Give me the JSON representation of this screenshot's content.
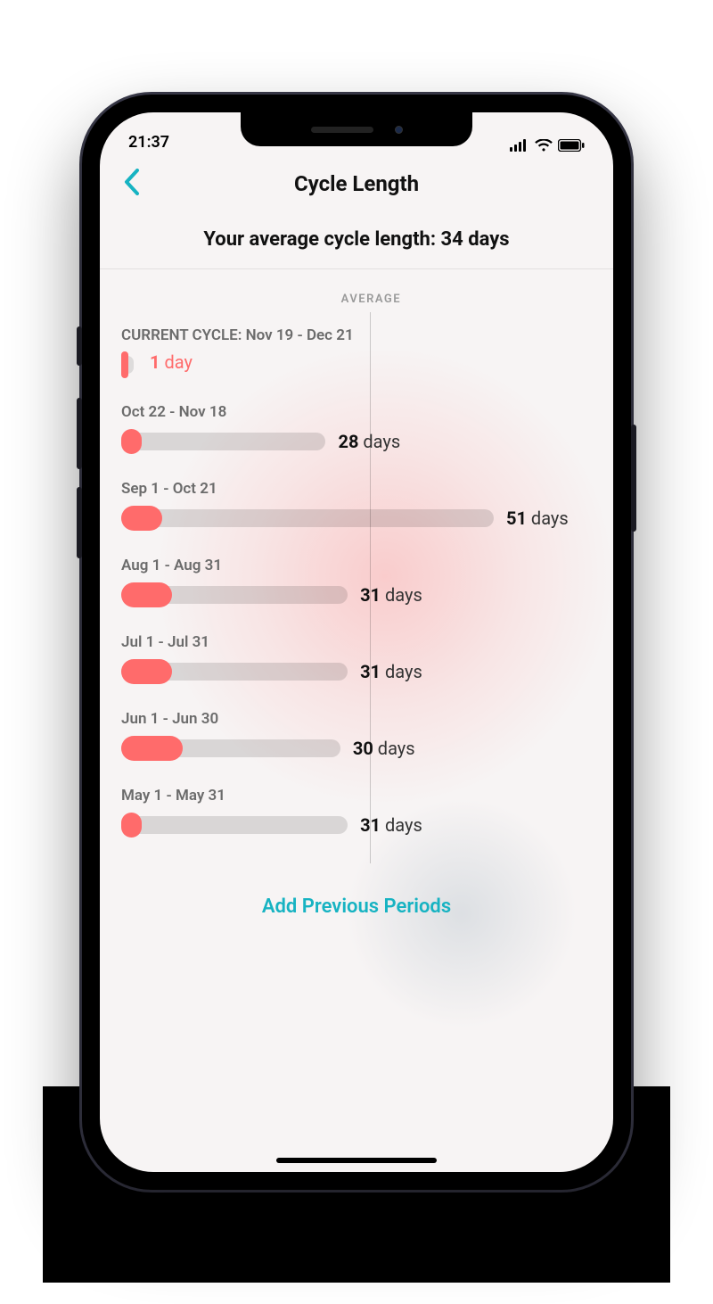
{
  "status_bar": {
    "time": "21:37"
  },
  "nav": {
    "title": "Cycle Length"
  },
  "summary": {
    "text": "Your average cycle length: 34 days"
  },
  "chart_data": {
    "type": "bar",
    "title": "Cycle Length",
    "ylabel": "days",
    "average": 34,
    "average_label": "AVERAGE",
    "max_bar_days": 51,
    "series": [
      {
        "name": "CURRENT CYCLE: Nov 19 - Dec 21",
        "value": 1,
        "unit": "day",
        "is_current": true,
        "period_days": 1
      },
      {
        "name": "Oct 22 - Nov 18",
        "value": 28,
        "unit": "days",
        "is_current": false,
        "period_days": 2
      },
      {
        "name": "Sep 1 - Oct 21",
        "value": 51,
        "unit": "days",
        "is_current": false,
        "period_days": 4
      },
      {
        "name": "Aug 1 - Aug 31",
        "value": 31,
        "unit": "days",
        "is_current": false,
        "period_days": 5
      },
      {
        "name": "Jul 1 - Jul 31",
        "value": 31,
        "unit": "days",
        "is_current": false,
        "period_days": 5
      },
      {
        "name": "Jun 1 - Jun 30",
        "value": 30,
        "unit": "days",
        "is_current": false,
        "period_days": 6
      },
      {
        "name": "May 1 - May 31",
        "value": 31,
        "unit": "days",
        "is_current": false,
        "period_days": 2
      }
    ]
  },
  "footer": {
    "add_link": "Add Previous Periods"
  },
  "colors": {
    "accent": "#17b3c2",
    "bar": "#ff6b6b"
  }
}
